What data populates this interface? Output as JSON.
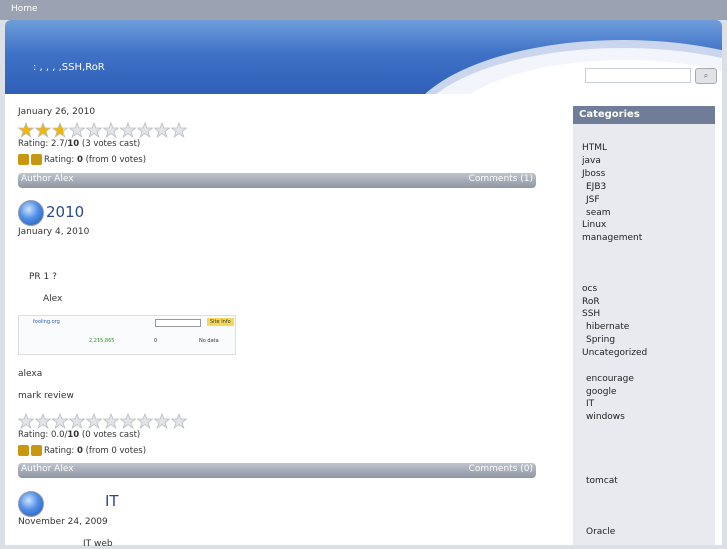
{
  "nav": {
    "home": "Home"
  },
  "header": {
    "site_title": ":     ,   ,   ,   ,SSH,RoR",
    "search_placeholder": "",
    "search_button": "⌕"
  },
  "posts": [
    {
      "date": "January 26, 2010",
      "rating_value": 2.7,
      "rating_text_prefix": "Rating: 2.7/",
      "rating_max": "10",
      "rating_votes": " (3 votes cast)",
      "vote_prefix": "Rating: ",
      "vote_score": "0",
      "vote_suffix": " (from 0 votes)",
      "author": "Author Alex",
      "comments": "Comments (1)"
    },
    {
      "title": "2010",
      "date": "January 4, 2010",
      "lines": [
        "PR   1          ?",
        "Alex",
        "alexa",
        "mark            review"
      ],
      "image_text": {
        "site": "fooling.org",
        "badge": "Site Info",
        "rank": "2,215,865",
        "links": "0",
        "speed": "No data"
      },
      "rating_value": 0.0,
      "rating_text_prefix": "Rating: 0.0/",
      "rating_max": "10",
      "rating_votes": " (0 votes cast)",
      "vote_prefix": "Rating: ",
      "vote_score": "0",
      "vote_suffix": " (from 0 votes)",
      "author": "Author Alex",
      "comments": "Comments (0)"
    },
    {
      "title": "IT",
      "date": "November 24, 2009",
      "lines": [
        "IT                web"
      ]
    }
  ],
  "sidebar": {
    "title": "Categories",
    "items": [
      "HTML",
      "java",
      "Jboss",
      "EJB3",
      "JSF",
      "seam",
      "Linux",
      "management",
      "ocs",
      "RoR",
      "SSH",
      "hibernate",
      "Spring",
      "Uncategorized",
      "encourage",
      "google",
      "IT",
      "windows",
      "tomcat",
      "Oracle"
    ]
  },
  "colors": {
    "star_on": "#f2b705",
    "star_off": "#e2e4e8",
    "title": "#2c4b8c"
  }
}
